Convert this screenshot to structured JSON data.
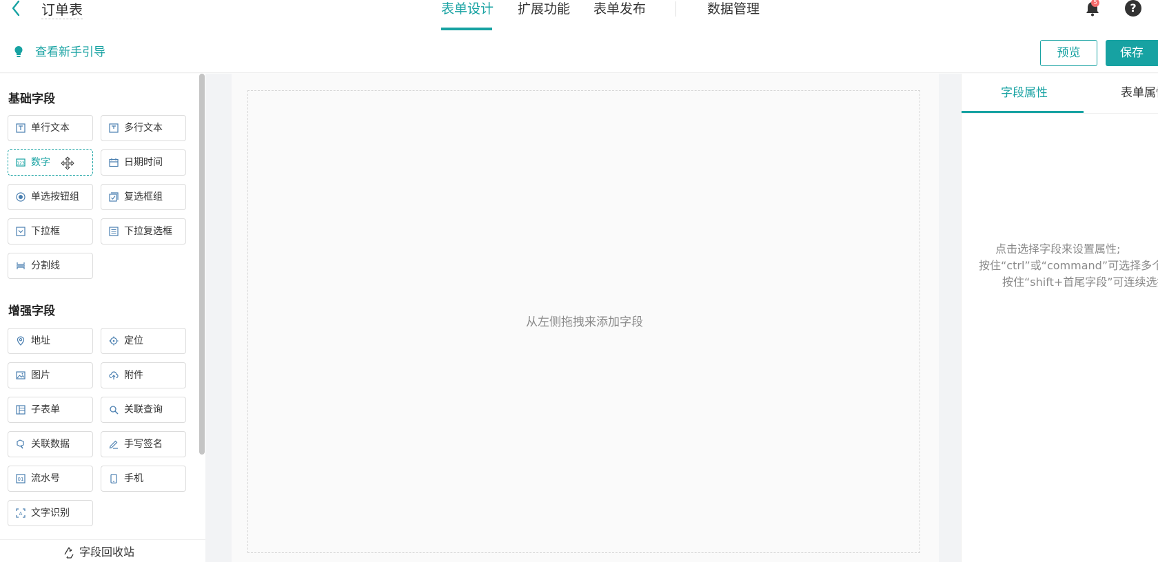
{
  "header": {
    "form_title": "订单表",
    "tabs": [
      {
        "label": "表单设计",
        "active": true
      },
      {
        "label": "扩展功能",
        "active": false
      },
      {
        "label": "表单发布",
        "active": false
      },
      {
        "label": "数据管理",
        "active": false
      }
    ],
    "notification_count": "5"
  },
  "guide": {
    "link_label": "查看新手引导",
    "preview_label": "预览",
    "save_label": "保存"
  },
  "left_panel": {
    "basic_title": "基础字段",
    "basic_fields": [
      {
        "label": "单行文本",
        "icon": "single-line-text-icon"
      },
      {
        "label": "多行文本",
        "icon": "multi-line-text-icon"
      },
      {
        "label": "数字",
        "icon": "number-icon"
      },
      {
        "label": "日期时间",
        "icon": "calendar-icon"
      },
      {
        "label": "单选按钮组",
        "icon": "radio-icon"
      },
      {
        "label": "复选框组",
        "icon": "checkbox-icon"
      },
      {
        "label": "下拉框",
        "icon": "dropdown-icon"
      },
      {
        "label": "下拉复选框",
        "icon": "dropdown-checkbox-icon"
      },
      {
        "label": "分割线",
        "icon": "divider-icon"
      }
    ],
    "advanced_title": "增强字段",
    "advanced_fields": [
      {
        "label": "地址",
        "icon": "location-pin-icon"
      },
      {
        "label": "定位",
        "icon": "crosshair-icon"
      },
      {
        "label": "图片",
        "icon": "image-icon"
      },
      {
        "label": "附件",
        "icon": "upload-cloud-icon"
      },
      {
        "label": "子表单",
        "icon": "subform-icon"
      },
      {
        "label": "关联查询",
        "icon": "link-search-icon"
      },
      {
        "label": "关联数据",
        "icon": "link-data-icon"
      },
      {
        "label": "手写签名",
        "icon": "pen-icon"
      },
      {
        "label": "流水号",
        "icon": "serial-number-icon"
      },
      {
        "label": "手机",
        "icon": "mobile-phone-icon"
      },
      {
        "label": "文字识别",
        "icon": "ocr-icon"
      }
    ],
    "recycle_label": "字段回收站"
  },
  "canvas": {
    "drop_hint": "从左侧拖拽来添加字段"
  },
  "right_panel": {
    "tabs": [
      {
        "label": "字段属性",
        "active": true
      },
      {
        "label": "表单属性",
        "active": false
      }
    ],
    "hint_lines": [
      "点击选择字段来设置属性;",
      "按住“ctrl”或“command”可选择多个字",
      "按住“shift+首尾字段”可连续选择"
    ]
  },
  "colors": {
    "accent": "#17a2a2",
    "badge": "#f56c6c"
  }
}
